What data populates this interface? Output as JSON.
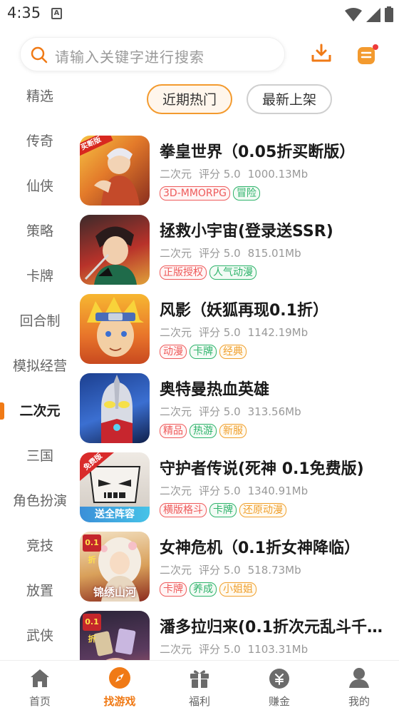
{
  "status": {
    "time": "4:35",
    "a_icon": "A"
  },
  "header": {
    "search_placeholder": "请输入关键字进行搜索",
    "icons": [
      "search-icon",
      "download-icon",
      "message-icon"
    ],
    "accent": "#f07a16"
  },
  "sidebar": {
    "items": [
      {
        "label": "精选"
      },
      {
        "label": "传奇"
      },
      {
        "label": "仙侠"
      },
      {
        "label": "策略"
      },
      {
        "label": "卡牌"
      },
      {
        "label": "回合制"
      },
      {
        "label": "模拟经营"
      },
      {
        "label": "二次元",
        "active": true
      },
      {
        "label": "三国"
      },
      {
        "label": "角色扮演"
      },
      {
        "label": "竞技"
      },
      {
        "label": "放置"
      },
      {
        "label": "武侠"
      }
    ]
  },
  "filters": {
    "hot": "近期热门",
    "new": "最新上架"
  },
  "games": [
    {
      "title": "拳皇世界（0.05折买断版）",
      "category": "二次元",
      "rating": "评分 5.0",
      "size": "1000.13Mb",
      "badge": "买断版",
      "tags": [
        {
          "text": "3D-MMORPG",
          "color": "red"
        },
        {
          "text": "冒险",
          "color": "green"
        }
      ]
    },
    {
      "title": "拯救小宇宙(登录送SSR)",
      "category": "二次元",
      "rating": "评分 5.0",
      "size": "815.01Mb",
      "badge": "",
      "tags": [
        {
          "text": "正版授权",
          "color": "red"
        },
        {
          "text": "人气动漫",
          "color": "green"
        }
      ]
    },
    {
      "title": "风影（妖狐再现0.1折）",
      "category": "二次元",
      "rating": "评分 5.0",
      "size": "1142.19Mb",
      "badge": "",
      "tags": [
        {
          "text": "动漫",
          "color": "red"
        },
        {
          "text": "卡牌",
          "color": "green"
        },
        {
          "text": "经典",
          "color": "orange"
        }
      ]
    },
    {
      "title": "奥特曼热血英雄",
      "category": "二次元",
      "rating": "评分 5.0",
      "size": "313.56Mb",
      "badge": "",
      "tags": [
        {
          "text": "精品",
          "color": "red"
        },
        {
          "text": "热游",
          "color": "green"
        },
        {
          "text": "新服",
          "color": "orange"
        }
      ]
    },
    {
      "title": "守护者传说(死神 0.1免费版)",
      "category": "二次元",
      "rating": "评分 5.0",
      "size": "1340.91Mb",
      "badge": "免费版",
      "banner": "送全阵容",
      "tags": [
        {
          "text": "横版格斗",
          "color": "red"
        },
        {
          "text": "卡牌",
          "color": "green"
        },
        {
          "text": "还原动漫",
          "color": "orange"
        }
      ]
    },
    {
      "title": "女神危机（0.1折女神降临）",
      "category": "二次元",
      "rating": "评分 5.0",
      "size": "518.73Mb",
      "badge": "0.1折",
      "banner": "锦绣山河",
      "tags": [
        {
          "text": "卡牌",
          "color": "red"
        },
        {
          "text": "养成",
          "color": "green"
        },
        {
          "text": "小姐姐",
          "color": "orange"
        }
      ]
    },
    {
      "title": "潘多拉归来(0.1折次元乱斗千…",
      "category": "二次元",
      "rating": "评分 5.0",
      "size": "1103.31Mb",
      "badge": "0.1折",
      "tags": [
        {
          "text": "",
          "color": "red"
        },
        {
          "text": "",
          "color": "green"
        }
      ]
    }
  ],
  "bottom_nav": [
    {
      "label": "首页",
      "icon": "home-icon"
    },
    {
      "label": "找游戏",
      "icon": "compass-icon",
      "active": true
    },
    {
      "label": "福利",
      "icon": "gift-icon"
    },
    {
      "label": "赚金",
      "icon": "money-bag-icon"
    },
    {
      "label": "我的",
      "icon": "user-icon"
    }
  ]
}
